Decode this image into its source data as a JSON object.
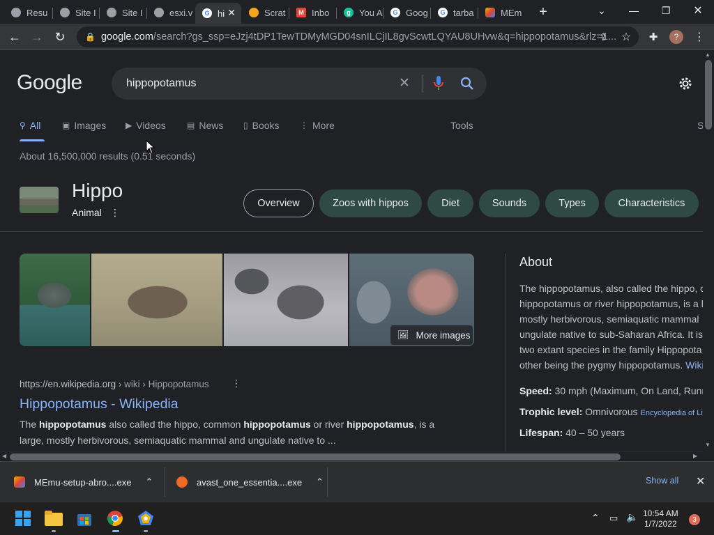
{
  "tabs": [
    {
      "label": "Resu",
      "icon": "chrome-icon"
    },
    {
      "label": "Site I",
      "icon": "chrome-icon"
    },
    {
      "label": "Site I",
      "icon": "chrome-icon"
    },
    {
      "label": "esxi.v",
      "icon": "chrome-icon"
    },
    {
      "label": "hi",
      "icon": "google-icon",
      "active": true
    },
    {
      "label": "Scrat",
      "icon": "scratch-icon"
    },
    {
      "label": "Inbo",
      "icon": "gmail-icon"
    },
    {
      "label": "You A",
      "icon": "grammarly-icon"
    },
    {
      "label": "Goog",
      "icon": "google-icon"
    },
    {
      "label": "tarba",
      "icon": "google-icon"
    },
    {
      "label": "MEm",
      "icon": "memu-icon"
    }
  ],
  "omnibox": {
    "host": "google.com",
    "path": "/search?gs_ssp=eJzj4tDP1TewTDMyMGD04snILCjIL8gvScwtLQYAU8UHvw&q=hippopotamus&rlz=1..."
  },
  "search": {
    "logo": "Google",
    "query": "hippopotamus"
  },
  "nav": {
    "all": "All",
    "images": "Images",
    "videos": "Videos",
    "news": "News",
    "books": "Books",
    "more": "More",
    "tools": "Tools",
    "safe": "S"
  },
  "stats": "About 16,500,000 results (0.51 seconds)",
  "knowledge": {
    "title": "Hippo",
    "subtitle": "Animal",
    "chips": [
      "Overview",
      "Zoos with hippos",
      "Diet",
      "Sounds",
      "Types",
      "Characteristics"
    ],
    "more_images": "More images"
  },
  "result": {
    "url": "https://en.wikipedia.org",
    "path": " › wiki › Hippopotamus",
    "title": "Hippopotamus - Wikipedia",
    "snippet_parts": [
      "The ",
      "hippopotamus",
      " also called the hippo, common ",
      "hippopotamus",
      " or river ",
      "hippopotamus",
      ", is a",
      "large, mostly herbivorous, semiaquatic mammal and ungulate native to ..."
    ]
  },
  "about": {
    "heading": "About",
    "lines": [
      "The hippopotamus, also called the hippo, c",
      "hippopotamus or river hippopotamus, is a l",
      "mostly herbivorous, semiaquatic mammal",
      "ungulate native to sub-Saharan Africa. It is",
      "two extant species in the family Hippopota",
      "other being the pygmy hippopotamus. "
    ],
    "wiki_link": "Wiki",
    "facts": [
      {
        "label": "Speed:",
        "value": " 30 mph (Maximum, On Land, Runn",
        "source": ""
      },
      {
        "label": "Trophic level:",
        "value": " Omnivorous ",
        "source": "Encyclopedia of Life"
      },
      {
        "label": "Lifespan:",
        "value": " 40 – 50 years",
        "source": ""
      }
    ]
  },
  "downloads": [
    {
      "name": "MEmu-setup-abro....exe",
      "icon": "memu-icon"
    },
    {
      "name": "avast_one_essentia....exe",
      "icon": "avast-icon"
    }
  ],
  "shelf": {
    "show_all": "Show all"
  },
  "taskbar": {
    "time": "10:54 AM",
    "date": "1/7/2022",
    "notifications": "3"
  },
  "colors": {
    "accent": "#8ab4f8",
    "chip": "#2f4a43",
    "background": "#202124"
  }
}
